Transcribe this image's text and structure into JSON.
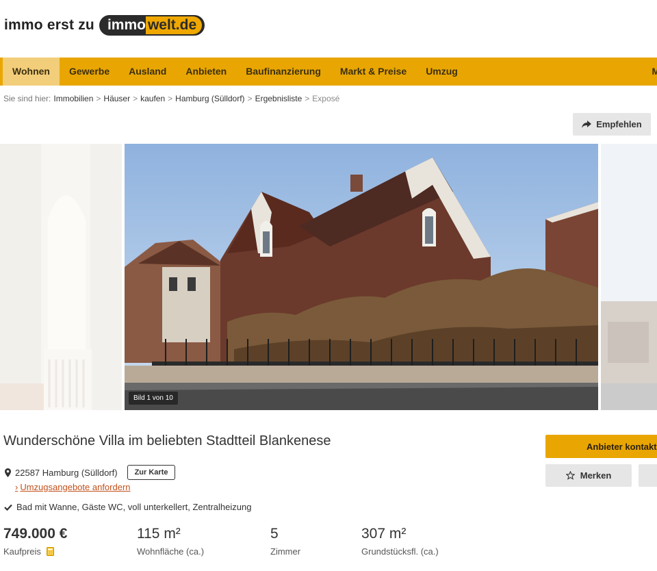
{
  "logo": {
    "prefix": "immo erst zu",
    "immo": "immo",
    "welt": "welt.de"
  },
  "nav": {
    "items": [
      "Wohnen",
      "Gewerbe",
      "Ausland",
      "Anbieten",
      "Baufinanzierung",
      "Markt & Preise",
      "Umzug"
    ],
    "right_label": "Me",
    "active_index": 0
  },
  "breadcrumb": {
    "prefix": "Sie sind hier:",
    "crumbs": [
      "Immobilien",
      "Häuser",
      "kaufen",
      "Hamburg (Sülldorf)",
      "Ergebnisliste"
    ],
    "current": "Exposé"
  },
  "share": {
    "label": "Empfehlen"
  },
  "gallery": {
    "counter": "Bild 1 von 10"
  },
  "listing": {
    "title": "Wunderschöne Villa im beliebten Stadtteil Blankenese",
    "address": "22587 Hamburg (Sülldorf)",
    "map_button": "Zur Karte",
    "move_link": "Umzugsangebote anfordern",
    "features": "Bad mit Wanne, Gäste WC, voll unterkellert, Zentralheizung"
  },
  "facts": [
    {
      "value": "749.000 €",
      "label": "Kaufpreis"
    },
    {
      "value": "115 m²",
      "label": "Wohnfläche (ca.)"
    },
    {
      "value": "5",
      "label": "Zimmer"
    },
    {
      "value": "307 m²",
      "label": "Grundstücksfl. (ca.)"
    }
  ],
  "actions": {
    "contact_label": "Anbieter kontaktieren",
    "save_label": "Merken"
  },
  "colors": {
    "accent": "#e9a602",
    "link": "#c2501b",
    "button_grey": "#e6e6e6"
  },
  "icons": [
    "share-icon",
    "map-pin-icon",
    "checkmark-icon",
    "calculator-icon",
    "envelope-icon",
    "star-icon"
  ]
}
